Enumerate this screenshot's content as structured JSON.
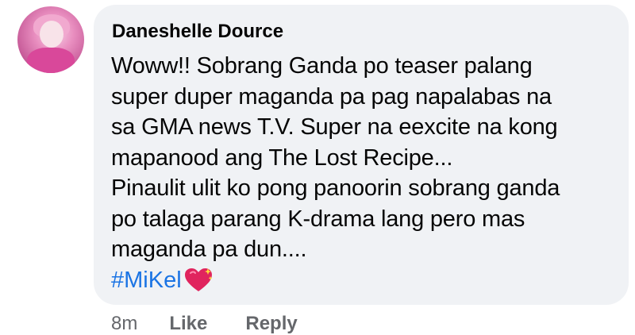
{
  "comment": {
    "author": "Daneshelle Dource",
    "text": "Woww!! Sobrang Ganda po teaser palang\nsuper duper maganda pa pag napalabas na\nsa GMA news T.V. Super na eexcite na kong\nmapanood ang The Lost Recipe...\nPinaulit ulit ko pong panoorin sobrang ganda\npo talaga parang K-drama lang pero mas\nmaganda pa dun....",
    "hashtag": "#MiKel",
    "emoji": "sparkling-heart-icon",
    "avatar": "profile-avatar"
  },
  "actions": {
    "time": "8m",
    "like": "Like",
    "reply": "Reply"
  },
  "colors": {
    "bubble": "#f0f2f5",
    "text": "#050505",
    "hashtag": "#1b74e4",
    "meta": "#65676b"
  }
}
